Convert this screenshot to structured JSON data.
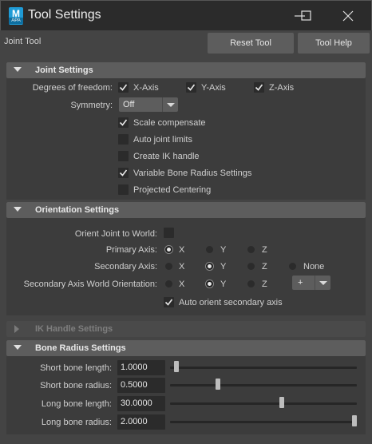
{
  "window": {
    "app_icon_letter": "M",
    "app_icon_sub": "APA",
    "title": "Tool Settings"
  },
  "toolbar": {
    "tool_name": "Joint Tool",
    "reset_label": "Reset Tool",
    "help_label": "Tool Help"
  },
  "joint_settings": {
    "header": "Joint Settings",
    "dof_label": "Degrees of freedom:",
    "dof": [
      {
        "label": "X-Axis",
        "checked": true
      },
      {
        "label": "Y-Axis",
        "checked": true
      },
      {
        "label": "Z-Axis",
        "checked": true
      }
    ],
    "symmetry_label": "Symmetry:",
    "symmetry_value": "Off",
    "options": [
      {
        "label": "Scale compensate",
        "checked": true
      },
      {
        "label": "Auto joint limits",
        "checked": false
      },
      {
        "label": "Create IK handle",
        "checked": false
      },
      {
        "label": "Variable Bone Radius Settings",
        "checked": true
      },
      {
        "label": "Projected Centering",
        "checked": false
      }
    ]
  },
  "orientation_settings": {
    "header": "Orientation Settings",
    "orient_world_label": "Orient Joint to World:",
    "orient_world_checked": false,
    "primary_axis_label": "Primary Axis:",
    "primary_axis_options": [
      "X",
      "Y",
      "Z"
    ],
    "primary_axis_selected": "X",
    "secondary_axis_label": "Secondary Axis:",
    "secondary_axis_options": [
      "X",
      "Y",
      "Z",
      "None"
    ],
    "secondary_axis_selected": "Y",
    "secondary_world_label": "Secondary Axis World Orientation:",
    "secondary_world_options": [
      "X",
      "Y",
      "Z"
    ],
    "secondary_world_selected": "Y",
    "secondary_world_sign": "+",
    "auto_orient_label": "Auto orient secondary axis",
    "auto_orient_checked": true
  },
  "ik_handle_settings": {
    "header": "IK Handle Settings",
    "collapsed": true
  },
  "bone_radius_settings": {
    "header": "Bone Radius Settings",
    "fields": [
      {
        "label": "Short bone length:",
        "value": "1.0000",
        "slider_fraction": 0.02
      },
      {
        "label": "Short bone radius:",
        "value": "0.5000",
        "slider_fraction": 0.25
      },
      {
        "label": "Long bone length:",
        "value": "30.0000",
        "slider_fraction": 0.6
      },
      {
        "label": "Long bone radius:",
        "value": "2.0000",
        "slider_fraction": 1.0
      }
    ]
  },
  "colors": {
    "background": "#444444",
    "panel": "#3c3c3c",
    "section_header": "#5d5d5d",
    "field": "#2b2b2b",
    "titlebar": "#2b2b2b",
    "maya_icon": "#1f9bd6"
  }
}
